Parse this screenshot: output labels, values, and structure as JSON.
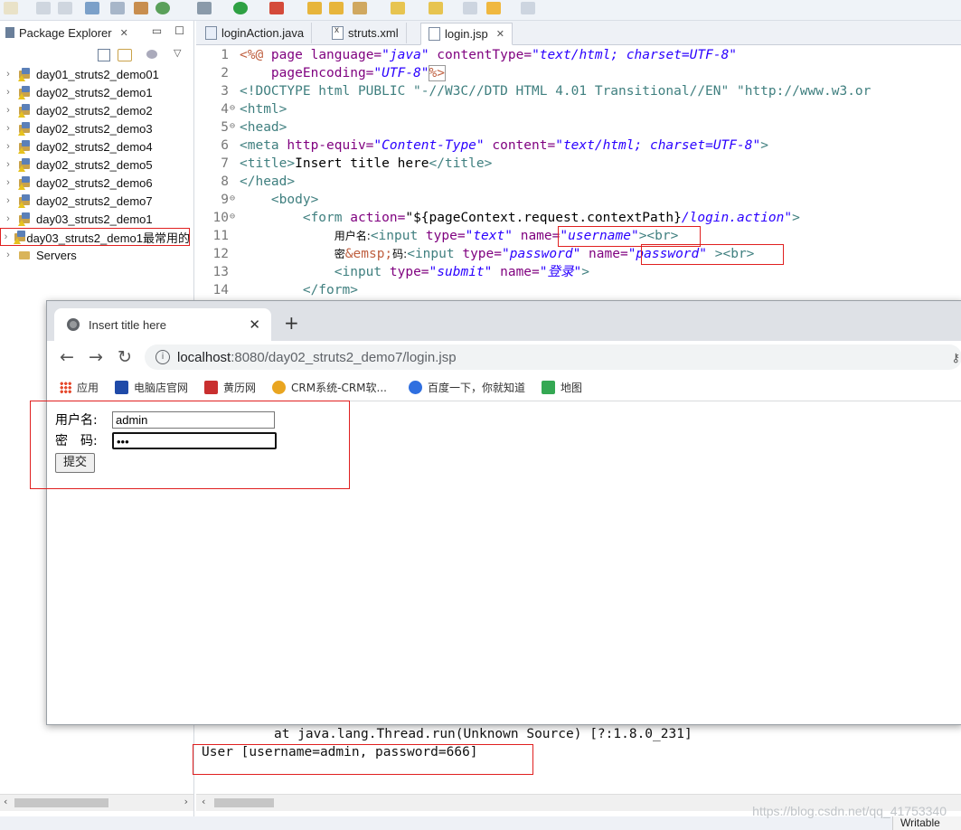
{
  "package_explorer": {
    "title": "Package Explorer",
    "projects": [
      {
        "name": "day01_struts2_demo01"
      },
      {
        "name": "day02_struts2_demo1"
      },
      {
        "name": "day02_struts2_demo2"
      },
      {
        "name": "day02_struts2_demo3"
      },
      {
        "name": "day02_struts2_demo4"
      },
      {
        "name": "day02_struts2_demo5"
      },
      {
        "name": "day02_struts2_demo6"
      },
      {
        "name": "day02_struts2_demo7"
      },
      {
        "name": "day03_struts2_demo1"
      },
      {
        "name": "day03_struts2_demo1最常用的"
      },
      {
        "name": "Servers"
      }
    ]
  },
  "editor": {
    "tabs": [
      {
        "label": "loginAction.java"
      },
      {
        "label": "struts.xml"
      },
      {
        "label": "login.jsp"
      }
    ],
    "active_tab": "login.jsp",
    "line_numbers": [
      "1",
      "2",
      "3",
      "4",
      "5",
      "6",
      "7",
      "8",
      "9",
      "10",
      "11",
      "12",
      "13",
      "14"
    ],
    "code": {
      "l1_open": "<%@",
      "l1_page": " page ",
      "l1_a1": "language=",
      "l1_v1": "\"java\"",
      "l1_a2": " contentType=",
      "l1_v2": "\"text/html; charset=UTF-8\"",
      "l2_a": "pageEncoding=",
      "l2_v": "\"UTF-8\"",
      "l2_close": "%>",
      "l3": "<!DOCTYPE html PUBLIC \"-//W3C//DTD HTML 4.01 Transitional//EN\" \"http://www.w3.or",
      "l4": "<html>",
      "l5": "<head>",
      "l6_tag": "<meta",
      "l6_a1": " http-equiv=",
      "l6_v1": "\"Content-Type\"",
      "l6_a2": " content=",
      "l6_v2": "\"text/html; charset=UTF-8\"",
      "l6_end": ">",
      "l7_open": "<title>",
      "l7_text": "Insert title here",
      "l7_close": "</title>",
      "l8": "</head>",
      "l9": "<body>",
      "l10_tag": "<form",
      "l10_a": " action=",
      "l10_v1": "\"${pageContext.request.contextPath}",
      "l10_v2": "/login.action",
      "l10_v3": "\"",
      "l10_end": ">",
      "l11_label": "用户名:",
      "l11_tag": "<input",
      "l11_a1": " type=",
      "l11_v1": "\"text\"",
      "l11_a2": "name=",
      "l11_v2": "\"username\"",
      "l11_end": "><br>",
      "l12_label1": "密",
      "l12_ent": "&emsp;",
      "l12_label2": "码:",
      "l12_tag": "<input",
      "l12_a1": " type=",
      "l12_v1": "\"password\"",
      "l12_a2": "name=",
      "l12_v2": "\"password\"",
      "l12_end": "><br>",
      "l13_tag": "<input",
      "l13_a1": " type=",
      "l13_v1": "\"submit\"",
      "l13_a2": " name=",
      "l13_v2": "\"登录\"",
      "l13_end": ">",
      "l14": "</form>"
    }
  },
  "console": {
    "stack_line": "at java.lang.Thread.run(Unknown Source) [?:1.8.0_231]",
    "output_line": "User [username=admin, password=666]"
  },
  "browser": {
    "tab_title": "Insert title here",
    "url_host": "localhost",
    "url_path": ":8080/day02_struts2_demo7/login.jsp",
    "bookmarks": [
      {
        "label": "应用",
        "color": "#e6492d"
      },
      {
        "label": "电脑店官网",
        "color": "#1f4aa8"
      },
      {
        "label": "黄历网",
        "color": "#c92f2f"
      },
      {
        "label": "CRM系统-CRM软...",
        "color": "#e9a520"
      },
      {
        "label": "百度一下，你就知道",
        "color": "#2f6fe0"
      },
      {
        "label": "地图",
        "color": "#34a853"
      }
    ],
    "form": {
      "username_label": "用户名:",
      "username_value": "admin",
      "password_label": "密　码:",
      "password_value": "•••",
      "submit_label": "提交"
    }
  },
  "status": {
    "writable": "Writable",
    "watermark": "https://blog.csdn.net/qq_41753340"
  }
}
